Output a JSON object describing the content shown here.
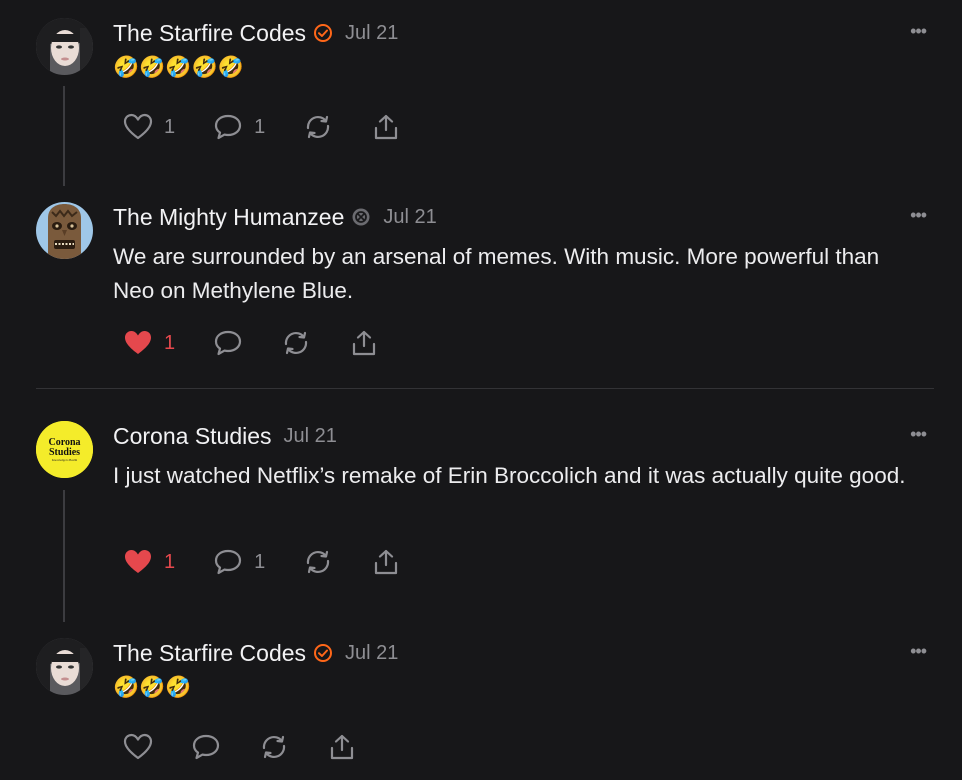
{
  "posts": [
    {
      "author": "The Starfire Codes",
      "badge": "verified-orange",
      "date": "Jul 21",
      "text": "",
      "emoji": [
        "🤣",
        "🤣",
        "🤣",
        "🤣",
        "🤣"
      ],
      "likes": "1",
      "liked": false,
      "comments": "1",
      "avatar": "woman-avatar"
    },
    {
      "author": "The Mighty Humanzee",
      "badge": "grey-badge",
      "date": "Jul 21",
      "text": "We are surrounded by an arsenal of memes. With music. More powerful than Neo on Methylene Blue.",
      "emoji": [],
      "likes": "1",
      "liked": true,
      "comments": "",
      "avatar": "tiki-mask-avatar"
    },
    {
      "author": "Corona Studies",
      "badge": "",
      "date": "Jul 21",
      "text": "I just watched Netflix’s remake of Erin Broccolich and it was actually quite good.",
      "emoji": [],
      "likes": "1",
      "liked": true,
      "comments": "1",
      "avatar": "corona-studies-logo",
      "avatar_logo_lines": [
        "Corona",
        "Studies",
        "Knowledge is Health"
      ]
    },
    {
      "author": "The Starfire Codes",
      "badge": "verified-orange",
      "date": "Jul 21",
      "text": "",
      "emoji": [
        "🤣",
        "🤣",
        "🤣"
      ],
      "likes": "",
      "liked": false,
      "comments": "",
      "avatar": "woman-avatar"
    }
  ],
  "more_label": "•••",
  "colors": {
    "background": "#171719",
    "liked": "#e5484d",
    "verified": "#ff6719",
    "muted": "#8e8e93"
  }
}
